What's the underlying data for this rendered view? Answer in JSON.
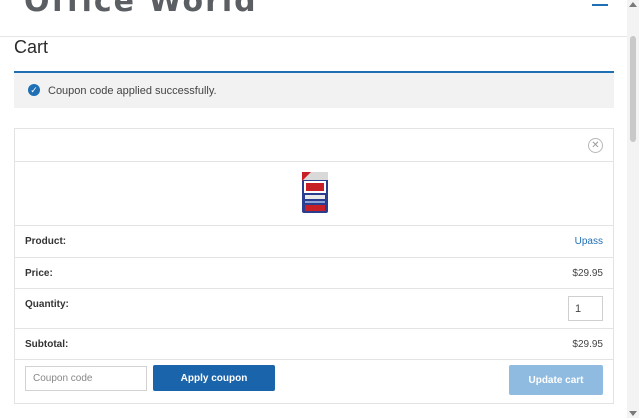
{
  "header": {
    "site_title": "Office World"
  },
  "page": {
    "title": "Cart"
  },
  "notice": {
    "message": "Coupon code applied successfully."
  },
  "cart": {
    "product_label": "Product:",
    "product_name": "Upass",
    "price_label": "Price:",
    "price": "$29.95",
    "quantity_label": "Quantity:",
    "quantity": "1",
    "subtotal_label": "Subtotal:",
    "subtotal": "$29.95"
  },
  "actions": {
    "coupon_placeholder": "Coupon code",
    "apply_coupon_label": "Apply coupon",
    "update_cart_label": "Update cart"
  },
  "colors": {
    "accent": "#1a64ab",
    "disabled_button": "#8fbbe0",
    "link": "#1f6fb5"
  },
  "icons": {
    "notice": "check-circle-icon",
    "remove": "close-circle-icon",
    "menu": "hamburger-menu-icon"
  }
}
